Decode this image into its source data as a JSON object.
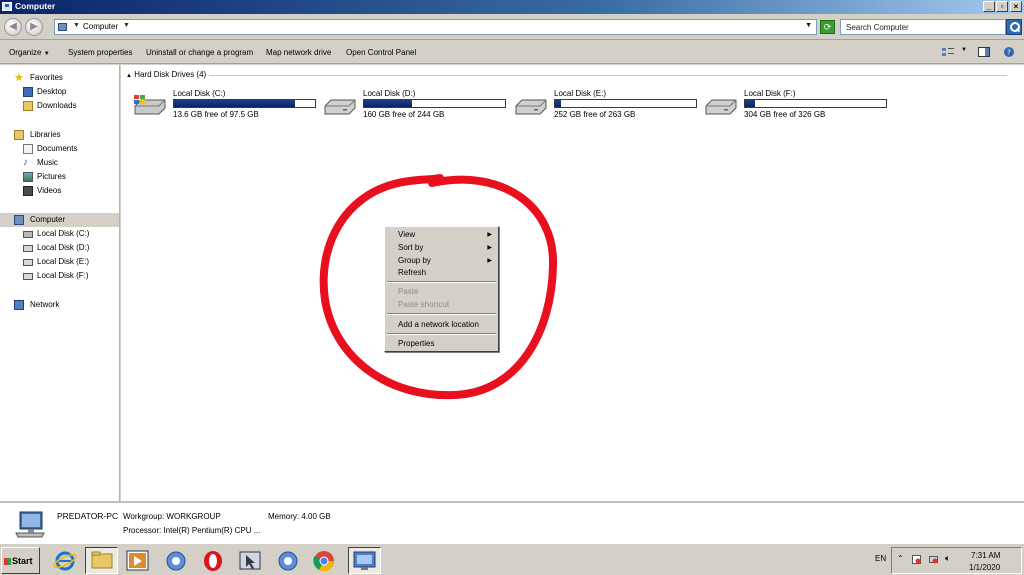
{
  "window": {
    "title": "Computer"
  },
  "address": {
    "crumb": "Computer",
    "search_placeholder": "Search Computer"
  },
  "toolbar": {
    "organize": "Organize",
    "system_properties": "System properties",
    "uninstall": "Uninstall or change a program",
    "map_drive": "Map network drive",
    "control_panel": "Open Control Panel"
  },
  "nav": {
    "favorites": "Favorites",
    "desktop": "Desktop",
    "downloads": "Downloads",
    "libraries": "Libraries",
    "documents": "Documents",
    "music": "Music",
    "pictures": "Pictures",
    "videos": "Videos",
    "computer": "Computer",
    "disk_c": "Local Disk (C:)",
    "disk_d": "Local Disk (D:)",
    "disk_e": "Local Disk (E:)",
    "disk_f": "Local Disk (F:)",
    "network": "Network"
  },
  "content": {
    "group_header": "Hard Disk Drives (4)",
    "drives": [
      {
        "name": "Local Disk (C:)",
        "free": "13.6 GB free of 97.5 GB",
        "used_fraction": 0.86
      },
      {
        "name": "Local Disk (D:)",
        "free": "160 GB free of 244 GB",
        "used_fraction": 0.34
      },
      {
        "name": "Local Disk (E:)",
        "free": "252 GB free of 263 GB",
        "used_fraction": 0.04
      },
      {
        "name": "Local Disk (F:)",
        "free": "304 GB free of 326 GB",
        "used_fraction": 0.07
      }
    ]
  },
  "context_menu": {
    "view": "View",
    "sort_by": "Sort by",
    "group_by": "Group by",
    "refresh": "Refresh",
    "paste": "Paste",
    "paste_shortcut": "Paste shortcut",
    "add_network_location": "Add a network location",
    "properties": "Properties"
  },
  "details": {
    "pc_name": "PREDATOR-PC",
    "workgroup": "Workgroup: WORKGROUP",
    "memory": "Memory: 4.00 GB",
    "processor": "Processor: Intel(R) Pentium(R) CPU ..."
  },
  "taskbar": {
    "start": "Start",
    "lang": "EN",
    "time": "7:31 AM",
    "date": "1/1/2020"
  },
  "colors": {
    "annotation": "#e8101e",
    "title_bar": "#0a246a",
    "drive_bar": "#0b2460"
  }
}
